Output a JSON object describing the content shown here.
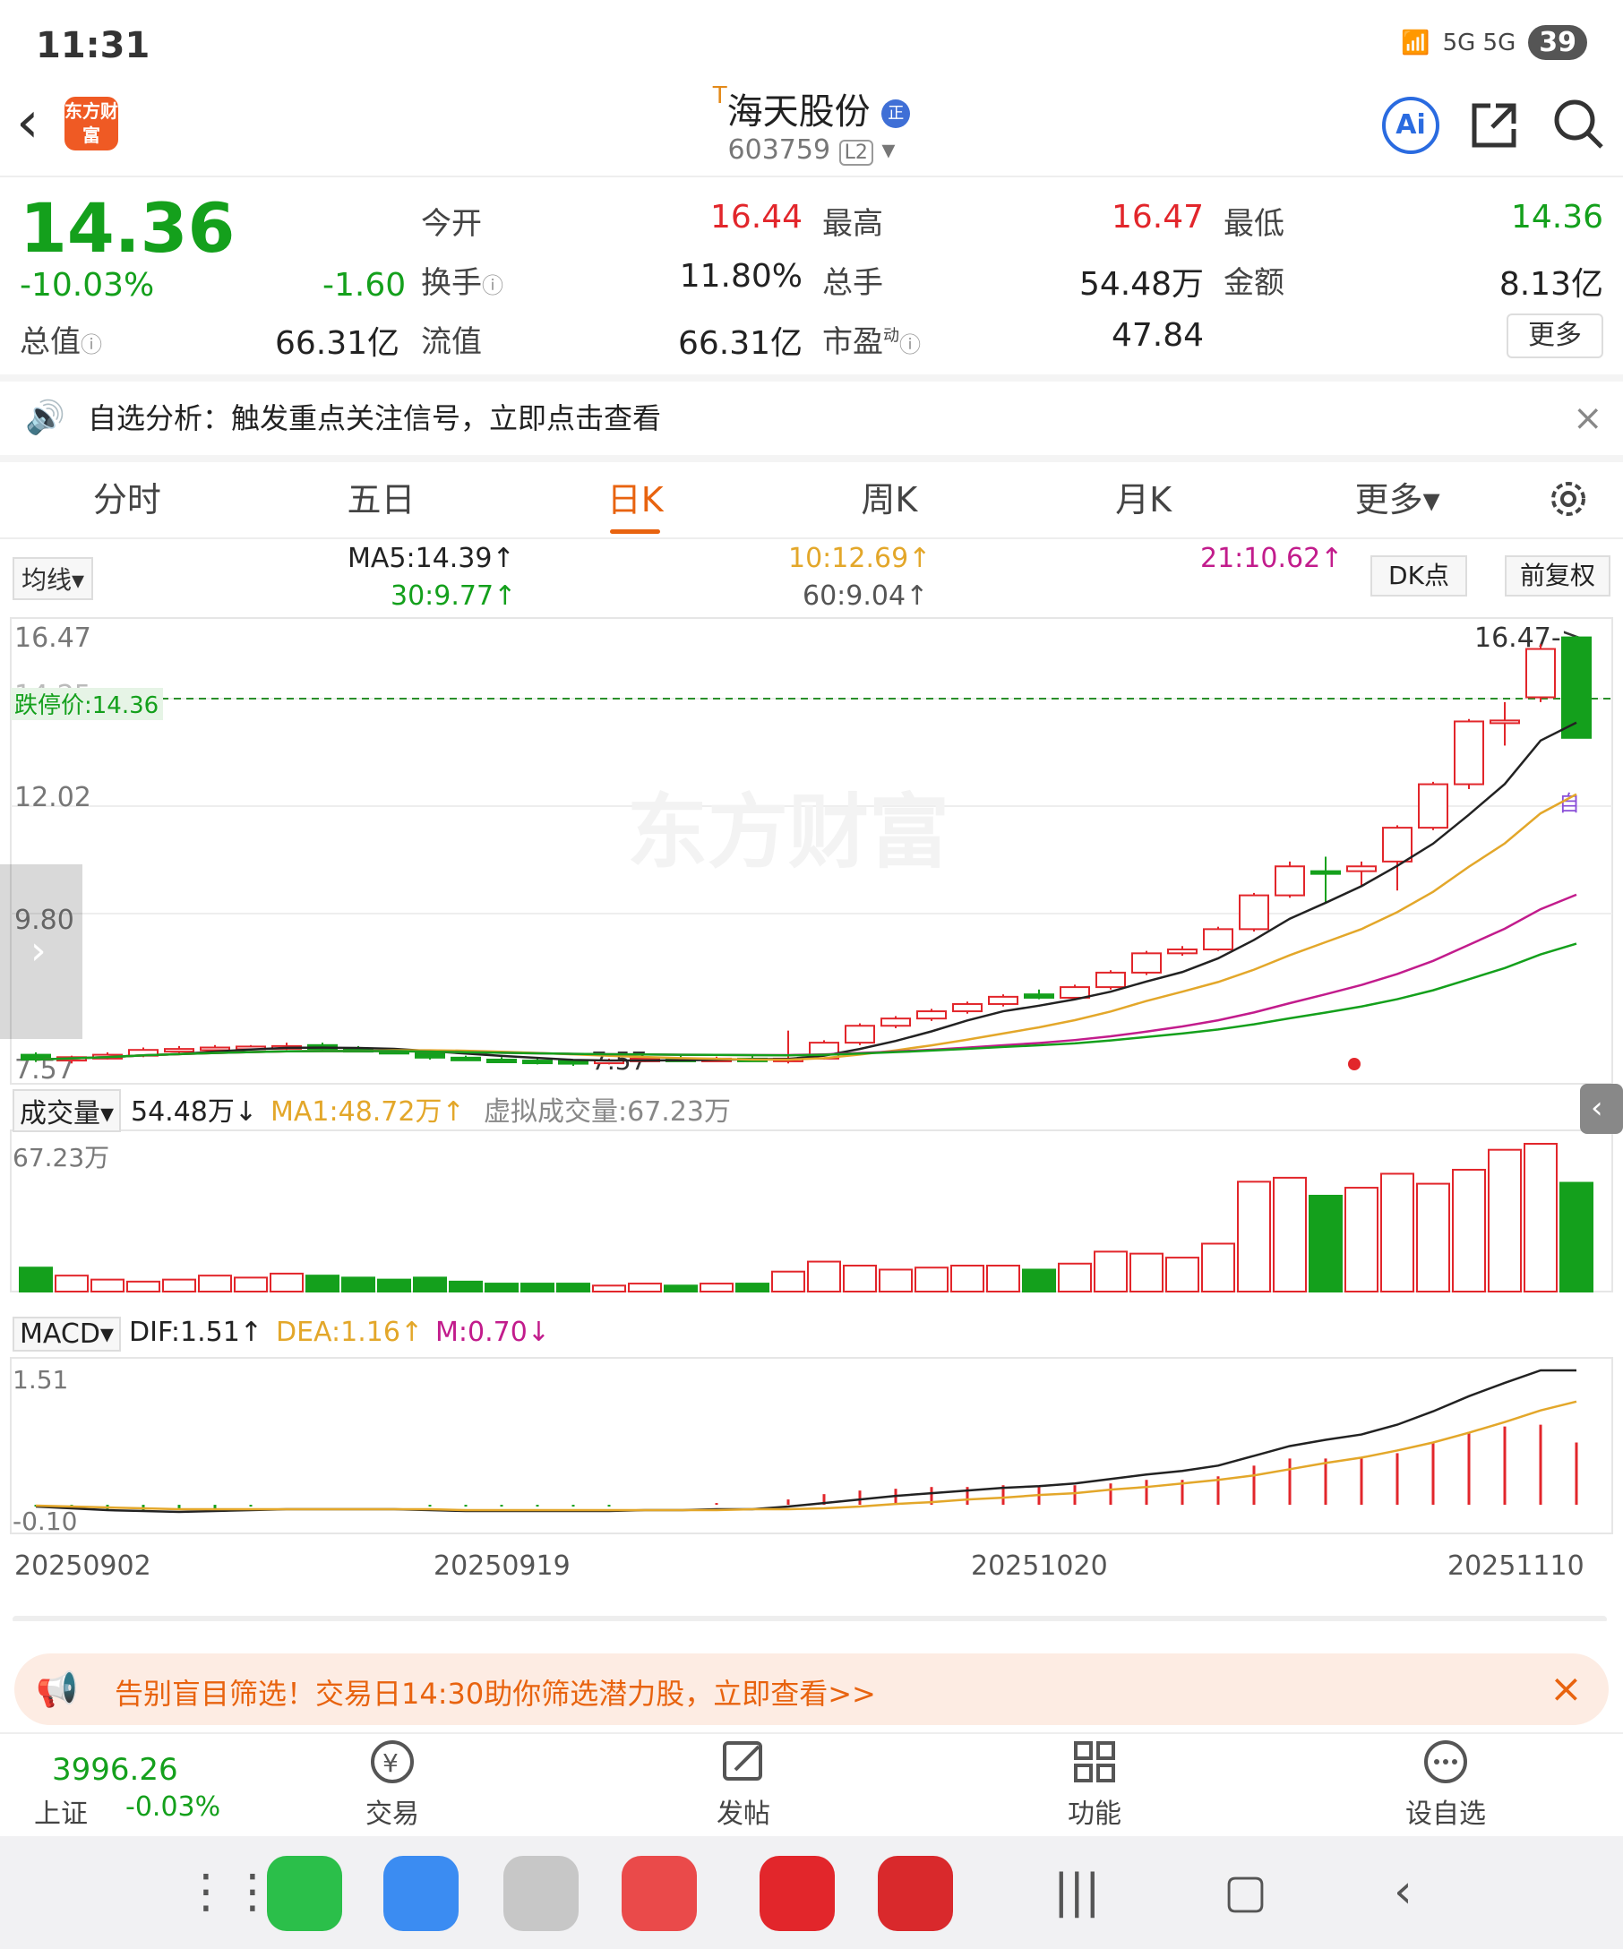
{
  "status_bar": {
    "time": "11:31",
    "signal": "5G 5G",
    "battery": "39"
  },
  "header": {
    "app_logo": "东方财富",
    "stock_prefix": "T",
    "stock_name": "海天股份",
    "stock_badge": "正",
    "stock_code": "603759",
    "level": "L2",
    "ai_label": "Ai"
  },
  "quote": {
    "price": "14.36",
    "change_pct": "-10.03%",
    "change": "-1.60",
    "open_label": "今开",
    "open": "16.44",
    "high_label": "最高",
    "high": "16.47",
    "low_label": "最低",
    "low": "14.36",
    "turnover_label": "换手",
    "turnover": "11.80%",
    "volume_label": "总手",
    "volume": "54.48万",
    "amount_label": "金额",
    "amount": "8.13亿",
    "mktcap_label": "总值",
    "mktcap": "66.31亿",
    "float_label": "流值",
    "float_cap": "66.31亿",
    "pe_label": "市盈",
    "pe_sup": "动",
    "pe": "47.84",
    "more": "更多"
  },
  "notice": {
    "text": "自选分析：触发重点关注信号，立即点击查看"
  },
  "tabs": [
    "分时",
    "五日",
    "日K",
    "周K",
    "月K",
    "更多▾"
  ],
  "ma_legend": {
    "selector": "均线▾",
    "ma5": "MA5:14.39↑",
    "ma10": "10:12.69↑",
    "ma21": "21:10.62↑",
    "ma30": "30:9.77↑",
    "ma60": "60:9.04↑",
    "dk": "DK点",
    "fq": "前复权"
  },
  "chart_labels": {
    "y_top": "16.47",
    "y_mid1": "12.02",
    "y_mid2": "9.80",
    "y_bottom": "7.57",
    "limit_down": "跌停价:14.36",
    "ghost": "14.25",
    "high_marker": "16.47->",
    "low_marker": "7.57",
    "watermark": "东方财富",
    "self_tag": "自"
  },
  "volume_legend": {
    "selector": "成交量▾",
    "vol": "54.48万↓",
    "ma1": "MA1:48.72万↑",
    "virtual": "虚拟成交量:67.23万",
    "y_top": "67.23万"
  },
  "macd_legend": {
    "selector": "MACD▾",
    "dif": "DIF:1.51↑",
    "dea": "DEA:1.16↑",
    "m": "M:0.70↓",
    "y_top": "1.51",
    "y_bottom": "-0.10"
  },
  "x_axis": [
    "20250902",
    "20250919",
    "20251020",
    "20251110"
  ],
  "chart_data": {
    "type": "candlestick",
    "ylim": [
      7.57,
      16.47
    ],
    "candles": [
      {
        "o": 7.8,
        "c": 7.7,
        "h": 7.85,
        "l": 7.65
      },
      {
        "o": 7.68,
        "c": 7.75,
        "h": 7.78,
        "l": 7.62
      },
      {
        "o": 7.72,
        "c": 7.8,
        "h": 7.85,
        "l": 7.7
      },
      {
        "o": 7.78,
        "c": 7.9,
        "h": 7.95,
        "l": 7.75
      },
      {
        "o": 7.88,
        "c": 7.92,
        "h": 7.98,
        "l": 7.82
      },
      {
        "o": 7.9,
        "c": 7.95,
        "h": 8.0,
        "l": 7.85
      },
      {
        "o": 7.95,
        "c": 7.97,
        "h": 8.0,
        "l": 7.9
      },
      {
        "o": 7.96,
        "c": 7.98,
        "h": 8.05,
        "l": 7.9
      },
      {
        "o": 8.0,
        "c": 7.92,
        "h": 8.05,
        "l": 7.88
      },
      {
        "o": 7.92,
        "c": 7.88,
        "h": 7.98,
        "l": 7.85
      },
      {
        "o": 7.88,
        "c": 7.86,
        "h": 7.92,
        "l": 7.82
      },
      {
        "o": 7.86,
        "c": 7.74,
        "h": 7.9,
        "l": 7.7
      },
      {
        "o": 7.74,
        "c": 7.72,
        "h": 7.78,
        "l": 7.68
      },
      {
        "o": 7.7,
        "c": 7.68,
        "h": 7.75,
        "l": 7.65
      },
      {
        "o": 7.68,
        "c": 7.67,
        "h": 7.72,
        "l": 7.6
      },
      {
        "o": 7.67,
        "c": 7.66,
        "h": 7.7,
        "l": 7.57
      },
      {
        "o": 7.66,
        "c": 7.68,
        "h": 7.72,
        "l": 7.6
      },
      {
        "o": 7.68,
        "c": 7.72,
        "h": 7.75,
        "l": 7.65
      },
      {
        "o": 7.72,
        "c": 7.7,
        "h": 7.78,
        "l": 7.66
      },
      {
        "o": 7.7,
        "c": 7.72,
        "h": 7.76,
        "l": 7.66
      },
      {
        "o": 7.72,
        "c": 7.71,
        "h": 7.78,
        "l": 7.66
      },
      {
        "o": 7.68,
        "c": 7.72,
        "h": 8.3,
        "l": 7.62
      },
      {
        "o": 7.72,
        "c": 8.05,
        "h": 8.1,
        "l": 7.7
      },
      {
        "o": 8.05,
        "c": 8.4,
        "h": 8.45,
        "l": 8.0
      },
      {
        "o": 8.4,
        "c": 8.55,
        "h": 8.6,
        "l": 8.35
      },
      {
        "o": 8.55,
        "c": 8.7,
        "h": 8.75,
        "l": 8.5
      },
      {
        "o": 8.7,
        "c": 8.85,
        "h": 8.9,
        "l": 8.65
      },
      {
        "o": 8.85,
        "c": 9.0,
        "h": 9.05,
        "l": 8.8
      },
      {
        "o": 9.05,
        "c": 8.98,
        "h": 9.15,
        "l": 8.95
      },
      {
        "o": 8.98,
        "c": 9.2,
        "h": 9.25,
        "l": 8.95
      },
      {
        "o": 9.2,
        "c": 9.5,
        "h": 9.55,
        "l": 9.15
      },
      {
        "o": 9.5,
        "c": 9.9,
        "h": 9.95,
        "l": 9.45
      },
      {
        "o": 9.9,
        "c": 9.98,
        "h": 10.05,
        "l": 9.85
      },
      {
        "o": 9.98,
        "c": 10.4,
        "h": 10.45,
        "l": 9.95
      },
      {
        "o": 10.4,
        "c": 11.1,
        "h": 11.15,
        "l": 10.35
      },
      {
        "o": 11.1,
        "c": 11.7,
        "h": 11.8,
        "l": 11.05
      },
      {
        "o": 11.6,
        "c": 11.55,
        "h": 11.9,
        "l": 10.95
      },
      {
        "o": 11.6,
        "c": 11.7,
        "h": 11.8,
        "l": 11.3
      },
      {
        "o": 11.8,
        "c": 12.5,
        "h": 12.55,
        "l": 11.2
      },
      {
        "o": 12.5,
        "c": 13.4,
        "h": 13.45,
        "l": 12.45
      },
      {
        "o": 13.4,
        "c": 14.7,
        "h": 14.75,
        "l": 13.3
      },
      {
        "o": 14.7,
        "c": 14.72,
        "h": 15.1,
        "l": 14.2
      },
      {
        "o": 15.2,
        "c": 16.2,
        "h": 16.3,
        "l": 15.1
      },
      {
        "o": 16.44,
        "c": 14.36,
        "h": 16.47,
        "l": 14.36
      }
    ],
    "volume": [
      12,
      8,
      6,
      5,
      6,
      8,
      7,
      9,
      8,
      7,
      6,
      7,
      5,
      4,
      4,
      4,
      3,
      4,
      3,
      4,
      4,
      10,
      15,
      13,
      11,
      12,
      13,
      13,
      11,
      14,
      20,
      19,
      17,
      24,
      55,
      57,
      48,
      52,
      59,
      54,
      61,
      71,
      74,
      54.48
    ],
    "macd_dif": [
      -0.02,
      -0.04,
      -0.06,
      -0.07,
      -0.08,
      -0.07,
      -0.06,
      -0.05,
      -0.05,
      -0.05,
      -0.05,
      -0.06,
      -0.07,
      -0.07,
      -0.07,
      -0.07,
      -0.07,
      -0.06,
      -0.06,
      -0.05,
      -0.05,
      -0.02,
      0.02,
      0.06,
      0.1,
      0.13,
      0.16,
      0.19,
      0.21,
      0.24,
      0.29,
      0.34,
      0.38,
      0.44,
      0.55,
      0.66,
      0.73,
      0.79,
      0.9,
      1.05,
      1.22,
      1.37,
      1.51,
      1.51
    ],
    "macd_dea": [
      -0.01,
      -0.02,
      -0.03,
      -0.04,
      -0.05,
      -0.05,
      -0.05,
      -0.05,
      -0.05,
      -0.05,
      -0.05,
      -0.05,
      -0.06,
      -0.06,
      -0.06,
      -0.06,
      -0.06,
      -0.06,
      -0.06,
      -0.06,
      -0.05,
      -0.05,
      -0.04,
      -0.02,
      0.01,
      0.03,
      0.06,
      0.08,
      0.11,
      0.13,
      0.17,
      0.2,
      0.24,
      0.28,
      0.33,
      0.4,
      0.47,
      0.53,
      0.61,
      0.7,
      0.81,
      0.93,
      1.06,
      1.16
    ]
  }
}
